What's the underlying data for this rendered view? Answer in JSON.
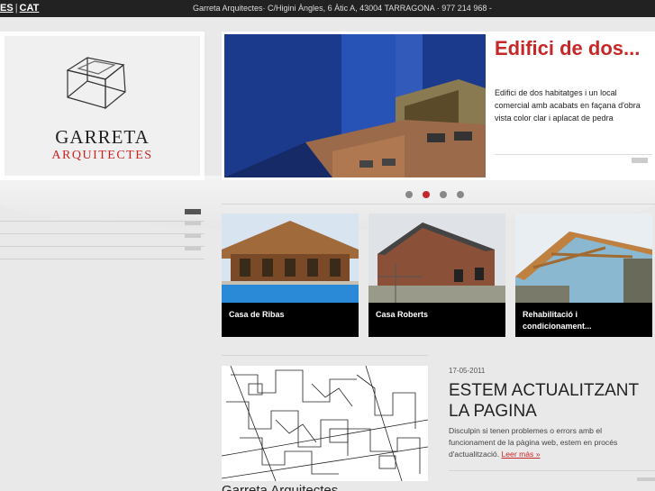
{
  "topbar": {
    "lang_es": "ES",
    "lang_sep": "|",
    "lang_cat": "CAT",
    "address": "Garreta Arquitectes· C/Higini Àngles, 6 Àtic A, 43004 TARRAGONA · 977 214 968 -"
  },
  "logo": {
    "name": "GARRETA",
    "sub": "ARQUITECTES",
    "icon": "cube-logo-icon"
  },
  "sidebar": {
    "items": [
      {
        "label": ""
      },
      {
        "label": ""
      },
      {
        "label": ""
      },
      {
        "label": ""
      }
    ]
  },
  "slider": {
    "title": "Edifici de dos...",
    "description": "Edifici de dos habitatges i un local comercial amb acabats en façana d'obra vista color clar i aplacat de pedra",
    "dots": 4,
    "active_dot": 1
  },
  "projects": [
    {
      "caption": "Casa de Ribas"
    },
    {
      "caption": "Casa Roberts"
    },
    {
      "caption": "Rehabilitació i condicionament..."
    }
  ],
  "news": {
    "date": "17-05-2011",
    "title": "ESTEM ACTUALITZANT LA PAGINA",
    "body": "Disculpin si tenen problemes o errors amb el funcionament de la pàgina web, estem en procés d'actualització.",
    "more": "Leer más »"
  },
  "bottom": {
    "title": "Garreta Arquitectes"
  },
  "colors": {
    "accent": "#c62828",
    "topbar": "#222222"
  }
}
